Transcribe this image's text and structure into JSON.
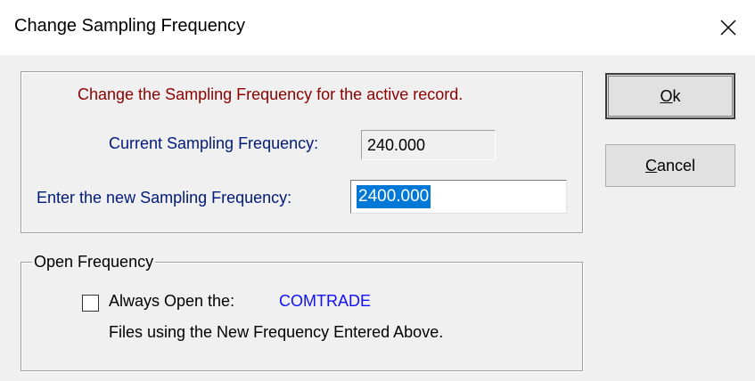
{
  "window": {
    "title": "Change Sampling Frequency",
    "close_icon": "close-icon"
  },
  "main": {
    "instruction": "Change the Sampling Frequency for the active record.",
    "current_label": "Current Sampling Frequency:",
    "current_value": "240.000",
    "new_label": "Enter the new Sampling Frequency:",
    "new_value": "2400.000"
  },
  "buttons": {
    "ok_hotkey": "O",
    "ok_rest": "k",
    "cancel_hotkey": "C",
    "cancel_rest": "ancel"
  },
  "open_frequency": {
    "legend": "Open Frequency",
    "checkbox_label": "Always Open the:",
    "format": "COMTRADE",
    "checked": false,
    "description": "Files using the New Frequency Entered Above."
  },
  "colors": {
    "instruction": "#8b0000",
    "labels": "#001a7a",
    "format": "#1010ff",
    "selection": "#0078d7"
  }
}
